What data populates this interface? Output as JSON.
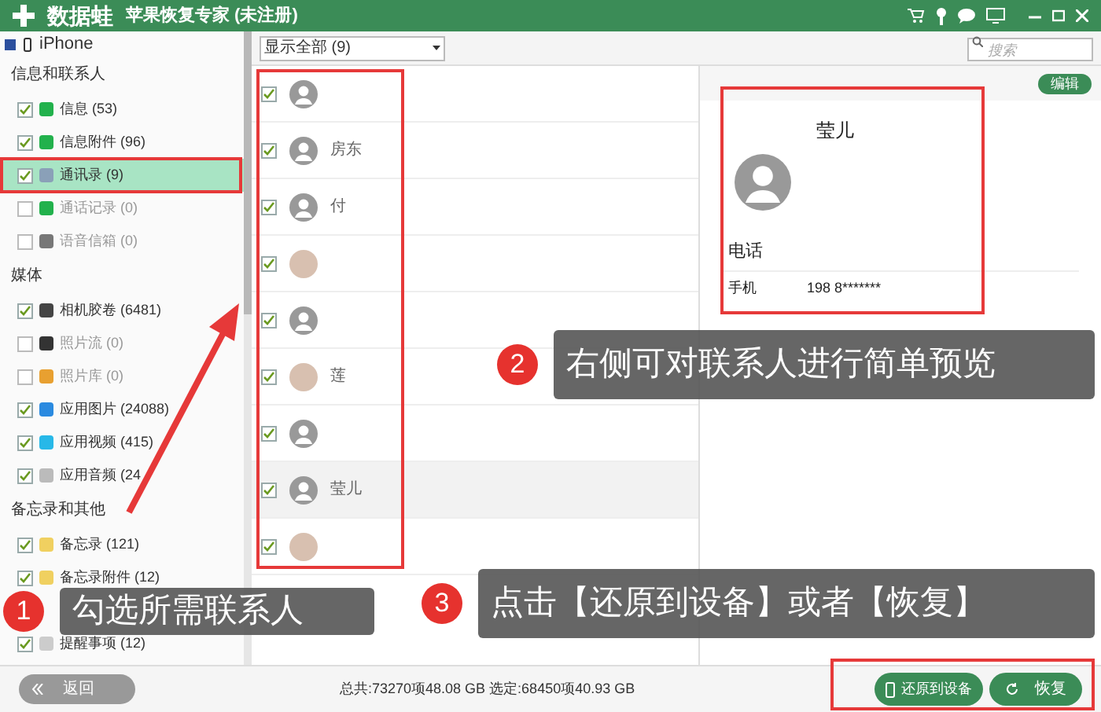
{
  "window": {
    "logo": "数据蛙",
    "title": "苹果恢复专家 (未注册)"
  },
  "device": {
    "name": "iPhone",
    "checked": true
  },
  "sidebar": {
    "sections": [
      {
        "title": "信息和联系人",
        "items": [
          {
            "label": "信息 (53)",
            "checked": true,
            "disabled": false,
            "selected": false,
            "color": "#22b14c"
          },
          {
            "label": "信息附件 (96)",
            "checked": true,
            "disabled": false,
            "selected": false,
            "color": "#22b14c"
          },
          {
            "label": "通讯录 (9)",
            "checked": true,
            "disabled": false,
            "selected": true,
            "color": "#8aa0b8"
          },
          {
            "label": "通话记录 (0)",
            "checked": false,
            "disabled": true,
            "selected": false,
            "color": "#22b14c"
          },
          {
            "label": "语音信箱 (0)",
            "checked": false,
            "disabled": true,
            "selected": false,
            "color": "#777777"
          }
        ]
      },
      {
        "title": "媒体",
        "items": [
          {
            "label": "相机胶卷 (6481)",
            "checked": true,
            "disabled": false,
            "selected": false,
            "color": "#444444"
          },
          {
            "label": "照片流 (0)",
            "checked": false,
            "disabled": true,
            "selected": false,
            "color": "#333333"
          },
          {
            "label": "照片库 (0)",
            "checked": false,
            "disabled": true,
            "selected": false,
            "color": "#e8a030"
          },
          {
            "label": "应用图片 (24088)",
            "checked": true,
            "disabled": false,
            "selected": false,
            "color": "#2a8ae0"
          },
          {
            "label": "应用视频 (415)",
            "checked": true,
            "disabled": false,
            "selected": false,
            "color": "#27b8e8"
          },
          {
            "label": "应用音频 (24",
            "checked": true,
            "disabled": false,
            "selected": false,
            "color": "#bbbbbb"
          }
        ]
      },
      {
        "title": "备忘录和其他",
        "items": [
          {
            "label": "备忘录 (121)",
            "checked": true,
            "disabled": false,
            "selected": false,
            "color": "#f0d060"
          },
          {
            "label": "备忘录附件 (12)",
            "checked": true,
            "disabled": false,
            "selected": false,
            "color": "#f0d060"
          },
          {
            "label": "提醒事项 (12)",
            "checked": true,
            "disabled": false,
            "selected": false,
            "color": "#cccccc"
          }
        ]
      }
    ]
  },
  "filter": {
    "value": "显示全部 (9)"
  },
  "search": {
    "placeholder": "搜索"
  },
  "contacts": [
    {
      "kind": "default",
      "checked": true,
      "selected": false
    },
    {
      "name": "房东",
      "kind": "default",
      "checked": true,
      "selected": false
    },
    {
      "name": "付",
      "kind": "default",
      "checked": true,
      "selected": false
    },
    {
      "kind": "photo",
      "checked": true,
      "selected": false
    },
    {
      "kind": "default",
      "checked": true,
      "selected": false
    },
    {
      "name": "莲",
      "kind": "photo",
      "checked": true,
      "selected": false
    },
    {
      "kind": "default",
      "checked": true,
      "selected": false
    },
    {
      "name": "莹儿",
      "kind": "default",
      "checked": true,
      "selected": true
    },
    {
      "kind": "photo",
      "checked": true,
      "selected": false
    }
  ],
  "detail": {
    "edit_button": "编辑",
    "name": "莹儿",
    "section": "电话",
    "phones": [
      {
        "label": "手机",
        "value": "198 8*******"
      }
    ]
  },
  "status_bar": {
    "back": "返回",
    "summary": "总共:73270项48.08 GB 选定:68450项40.93 GB",
    "restore_device": "还原到设备",
    "recover": "恢复"
  },
  "callouts": [
    {
      "number": "1",
      "text": "勾选所需联系人"
    },
    {
      "number": "2",
      "text": "右侧可对联系人进行简单预览"
    },
    {
      "number": "3",
      "text": "点击【还原到设备】或者【恢复】"
    }
  ]
}
